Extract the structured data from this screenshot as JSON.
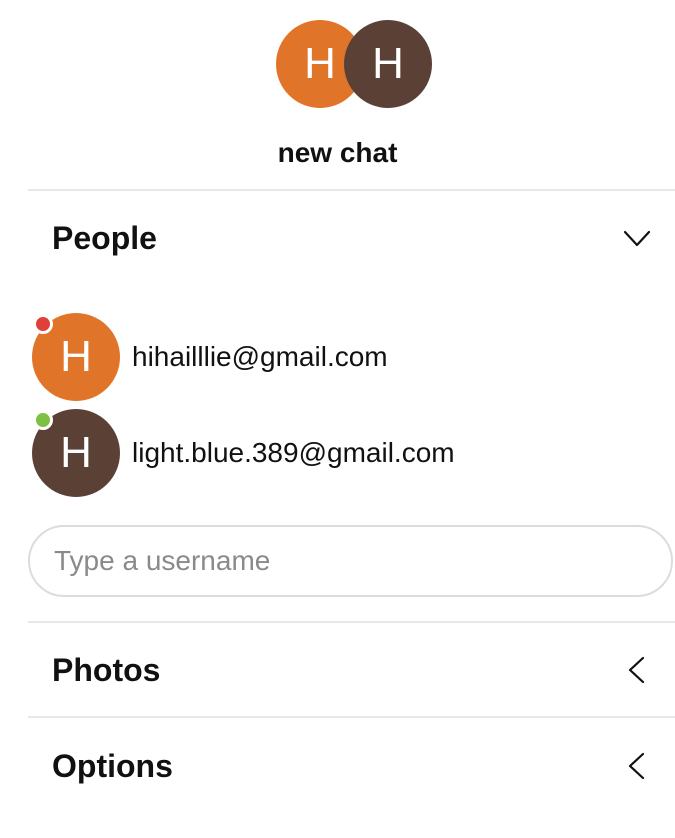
{
  "chat": {
    "title": "new chat",
    "header_avatars": [
      {
        "initial": "H",
        "color": "#E07428"
      },
      {
        "initial": "H",
        "color": "#5B4036"
      }
    ]
  },
  "sections": {
    "people": {
      "label": "People",
      "state_icon": "chevron-down-icon"
    },
    "photos": {
      "label": "Photos",
      "state_icon": "chevron-left-icon"
    },
    "options": {
      "label": "Options",
      "state_icon": "chevron-left-icon"
    }
  },
  "people": [
    {
      "initial": "H",
      "email": "hihailllie@gmail.com",
      "avatar_color": "#E07428",
      "status_color": "#E0403A"
    },
    {
      "initial": "H",
      "email": "light.blue.389@gmail.com",
      "avatar_color": "#5B4036",
      "status_color": "#7DC043"
    }
  ],
  "username_input": {
    "placeholder": "Type a username",
    "value": ""
  }
}
